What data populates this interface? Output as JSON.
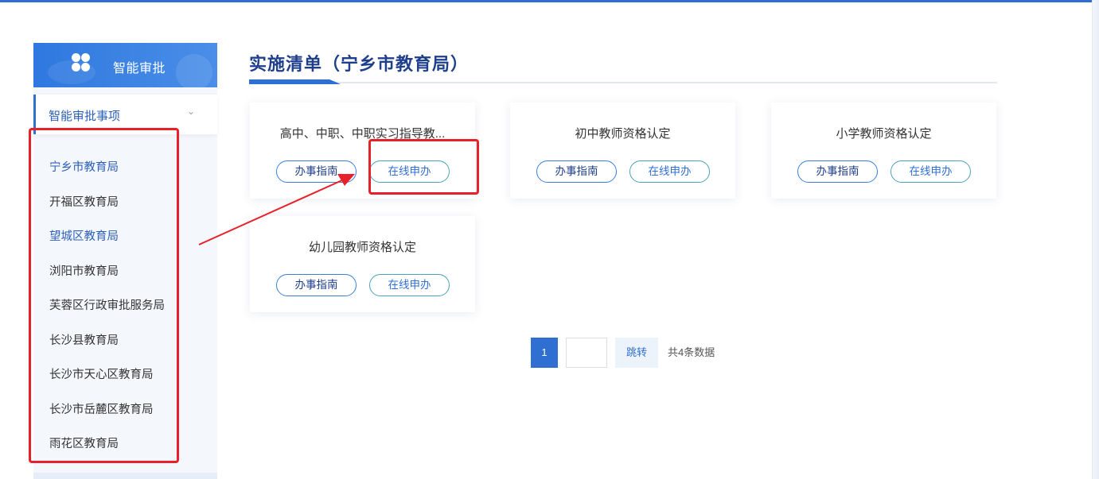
{
  "sidebar": {
    "header_title": "智能审批",
    "submenu_label": "智能审批事项",
    "chevron": "chevron-down-icon",
    "items": [
      {
        "label": "宁乡市教育局",
        "active": true
      },
      {
        "label": "开福区教育局"
      },
      {
        "label": "望城区教育局",
        "highlight": true
      },
      {
        "label": "浏阳市教育局"
      },
      {
        "label": "芙蓉区行政审批服务局"
      },
      {
        "label": "长沙县教育局"
      },
      {
        "label": "长沙市天心区教育局"
      },
      {
        "label": "长沙市岳麓区教育局"
      },
      {
        "label": "雨花区教育局"
      }
    ]
  },
  "main": {
    "title": "实施清单（宁乡市教育局）",
    "cards": [
      {
        "name": "高中、中职、中职实习指导教...",
        "guide_label": "办事指南",
        "apply_label": "在线申办"
      },
      {
        "name": "初中教师资格认定",
        "guide_label": "办事指南",
        "apply_label": "在线申办"
      },
      {
        "name": "小学教师资格认定",
        "guide_label": "办事指南",
        "apply_label": "在线申办"
      },
      {
        "name": "幼儿园教师资格认定",
        "guide_label": "办事指南",
        "apply_label": "在线申办"
      }
    ]
  },
  "pagination": {
    "current_page": "1",
    "jump_label": "跳转",
    "total_text": "共4条数据"
  },
  "colors": {
    "primary": "#2f6fd1",
    "title": "#1f3f8c",
    "annotation": "#e8202a"
  }
}
